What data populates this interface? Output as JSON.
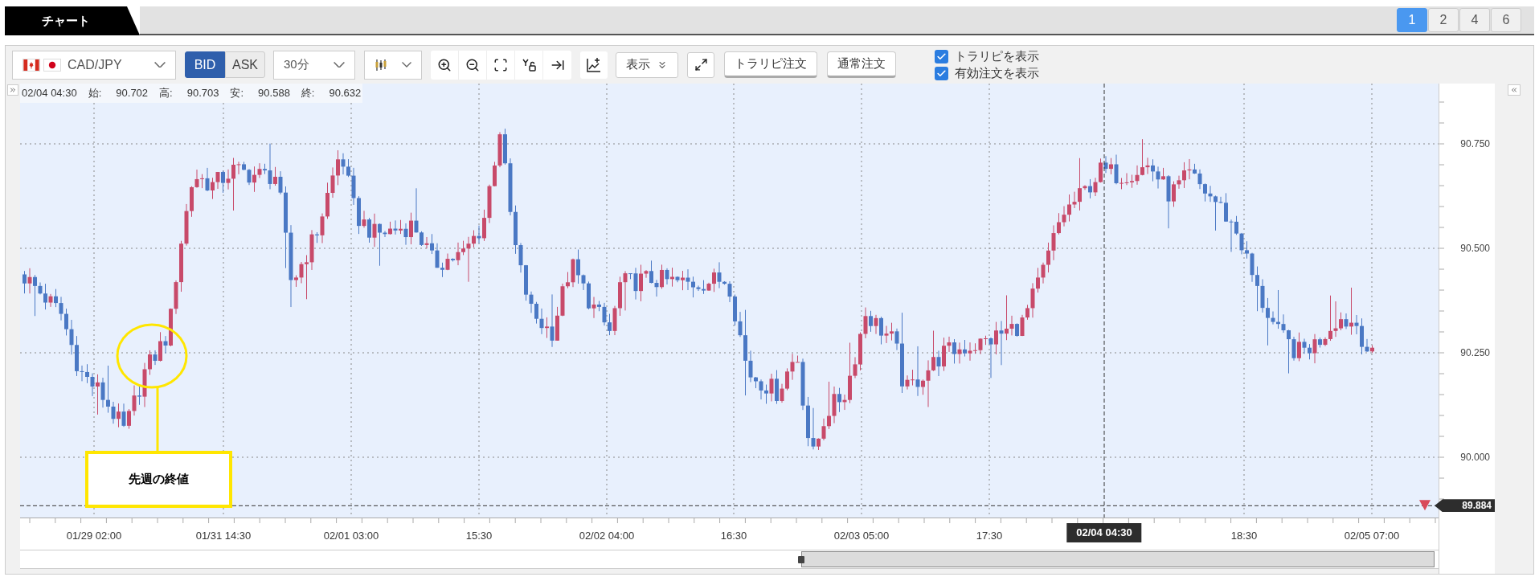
{
  "tab_bar": {
    "title": "チャート",
    "layouts": [
      {
        "label": "1",
        "selected": true
      },
      {
        "label": "2",
        "selected": false
      },
      {
        "label": "4",
        "selected": false
      },
      {
        "label": "6",
        "selected": false
      }
    ]
  },
  "toolbar": {
    "symbol": "CAD/JPY",
    "price_sides": [
      {
        "label": "BID",
        "selected": true
      },
      {
        "label": "ASK",
        "selected": false
      }
    ],
    "timeframe": "30分",
    "display_button": "表示",
    "order_buttons": [
      "トラリピ注文",
      "通常注文"
    ],
    "checkboxes": [
      {
        "label": "トラリピを表示",
        "checked": true
      },
      {
        "label": "有効注文を表示",
        "checked": true
      }
    ]
  },
  "info_bar": {
    "time": "02/04 04:30",
    "fields": [
      {
        "label": "始:",
        "value": "90.702"
      },
      {
        "label": "高:",
        "value": "90.703"
      },
      {
        "label": "安:",
        "value": "90.588"
      },
      {
        "label": "終:",
        "value": "90.632"
      }
    ]
  },
  "chart": {
    "price_labels": [
      "90.750",
      "90.500",
      "90.250",
      "90.000"
    ],
    "time_labels": [
      "01/29 02:00",
      "01/31 14:30",
      "02/01 03:00",
      "15:30",
      "02/02 04:00",
      "16:30",
      "02/03 05:00",
      "17:30",
      "18:30",
      "02/05 07:00"
    ],
    "crosshair_time": "02/04 04:30",
    "current_price": "89.884",
    "annotation": "先週の終値"
  }
}
